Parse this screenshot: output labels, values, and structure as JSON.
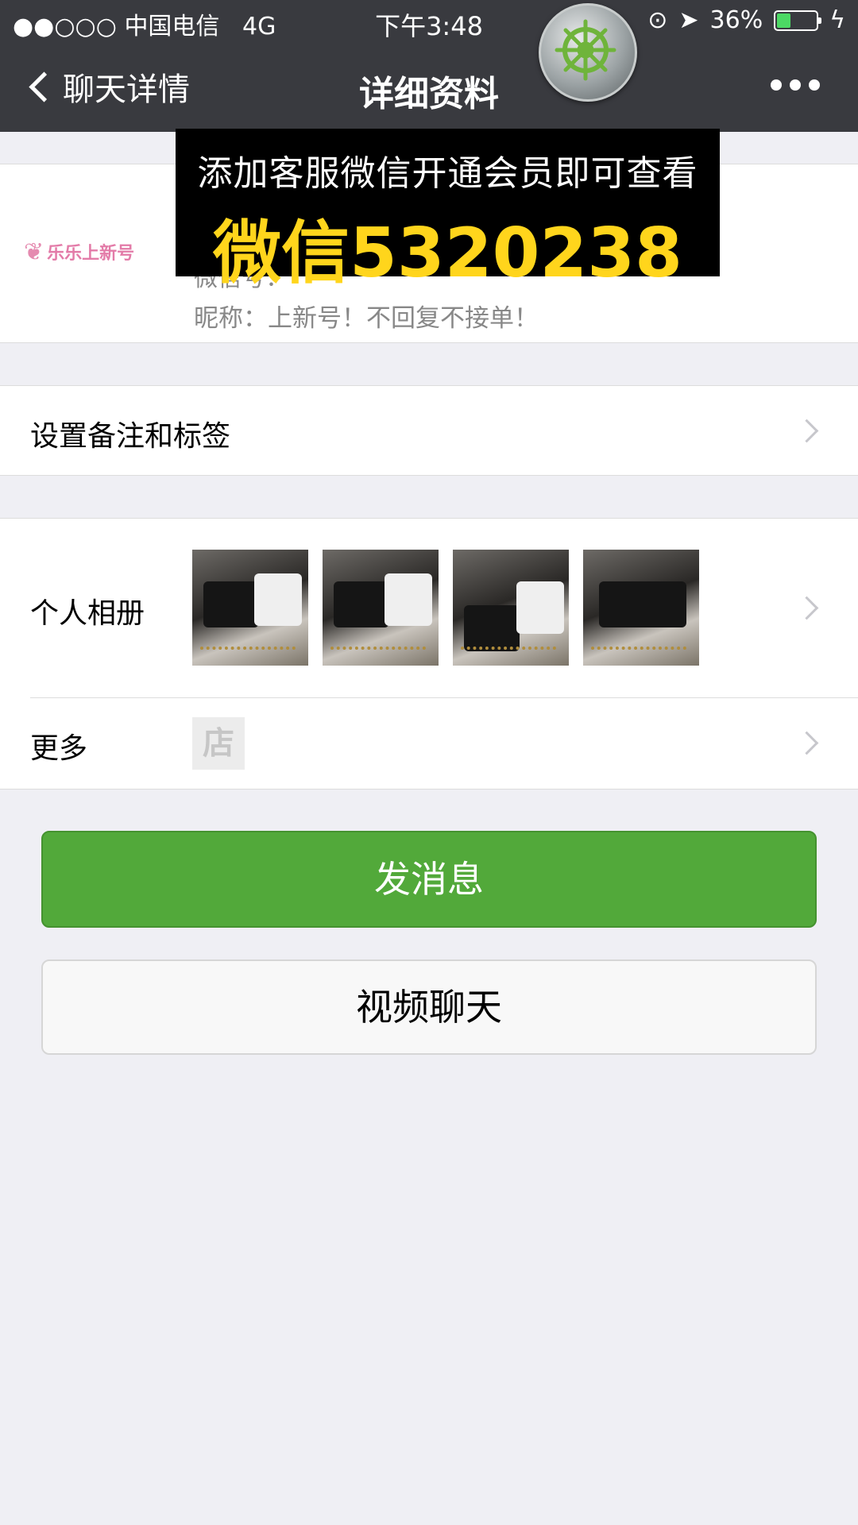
{
  "status_bar": {
    "signal": "●●○○○",
    "carrier": "中国电信",
    "network": "4G",
    "time": "下午3:48",
    "battery": "36%",
    "battery_level": 0.36
  },
  "nav": {
    "back_label": "聊天详情",
    "title": "详细资料"
  },
  "profile": {
    "avatar_text": "乐乐上新号",
    "wechat_id_line": "微信号：",
    "nickname_line": "昵称：上新号！不回复不接单！"
  },
  "overlay": {
    "line1": "添加客服微信开通会员即可查看",
    "line2": "微信5320238"
  },
  "cells": {
    "remark_label": "设置备注和标签",
    "album_label": "个人相册",
    "more_label": "更多",
    "shop_icon_text": "店"
  },
  "buttons": {
    "send": "发消息",
    "video": "视频聊天"
  },
  "colors": {
    "nav_bg": "#393a3f",
    "primary_green": "#52a93a",
    "banner_yellow": "#ffd51c",
    "page_bg": "#efeff4"
  }
}
